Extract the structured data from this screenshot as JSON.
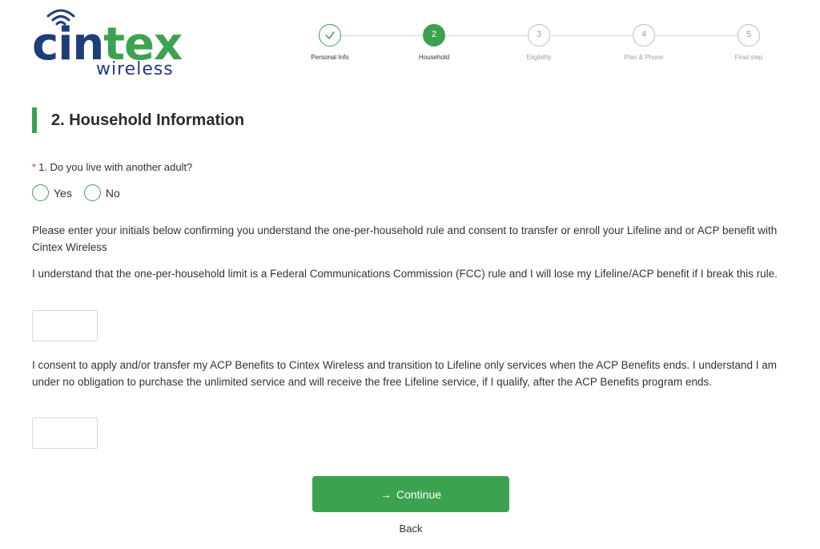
{
  "brand": {
    "logo_part1": "cin",
    "logo_part2": "tex",
    "logo_sub": "wireless",
    "color_blue": "#1f3d7a",
    "color_green": "#3ca24f"
  },
  "stepper": {
    "steps": [
      {
        "number": "✓",
        "label": "Personal Info",
        "state": "done"
      },
      {
        "number": "2",
        "label": "Household",
        "state": "active"
      },
      {
        "number": "3",
        "label": "Eligibility",
        "state": "upcoming"
      },
      {
        "number": "4",
        "label": "Plan & Phone",
        "state": "upcoming"
      },
      {
        "number": "5",
        "label": "Final step",
        "state": "upcoming"
      }
    ]
  },
  "section": {
    "title": "2. Household Information"
  },
  "question1": {
    "required_mark": "*",
    "text": "1. Do you live with another adult?",
    "options": [
      "Yes",
      "No"
    ]
  },
  "consent": {
    "intro": "Please enter your initials below confirming you understand the one-per-household rule and consent to transfer or enroll your Lifeline and or ACP benefit with Cintex Wireless",
    "rule": "I understand that the one-per-household limit is a Federal Communications Commission (FCC) rule and I will lose my Lifeline/ACP benefit if I break this rule.",
    "rule_initials_value": "",
    "acp": "I consent to apply and/or transfer my ACP Benefits to Cintex Wireless and transition to Lifeline only services when the ACP Benefits ends. I understand I am under no obligation to purchase the unlimited service and will receive the free Lifeline service, if I qualify, after the ACP Benefits program ends.",
    "acp_initials_value": ""
  },
  "actions": {
    "continue_label": "Continue",
    "continue_icon": "arrow-right-icon",
    "back_label": "Back"
  }
}
